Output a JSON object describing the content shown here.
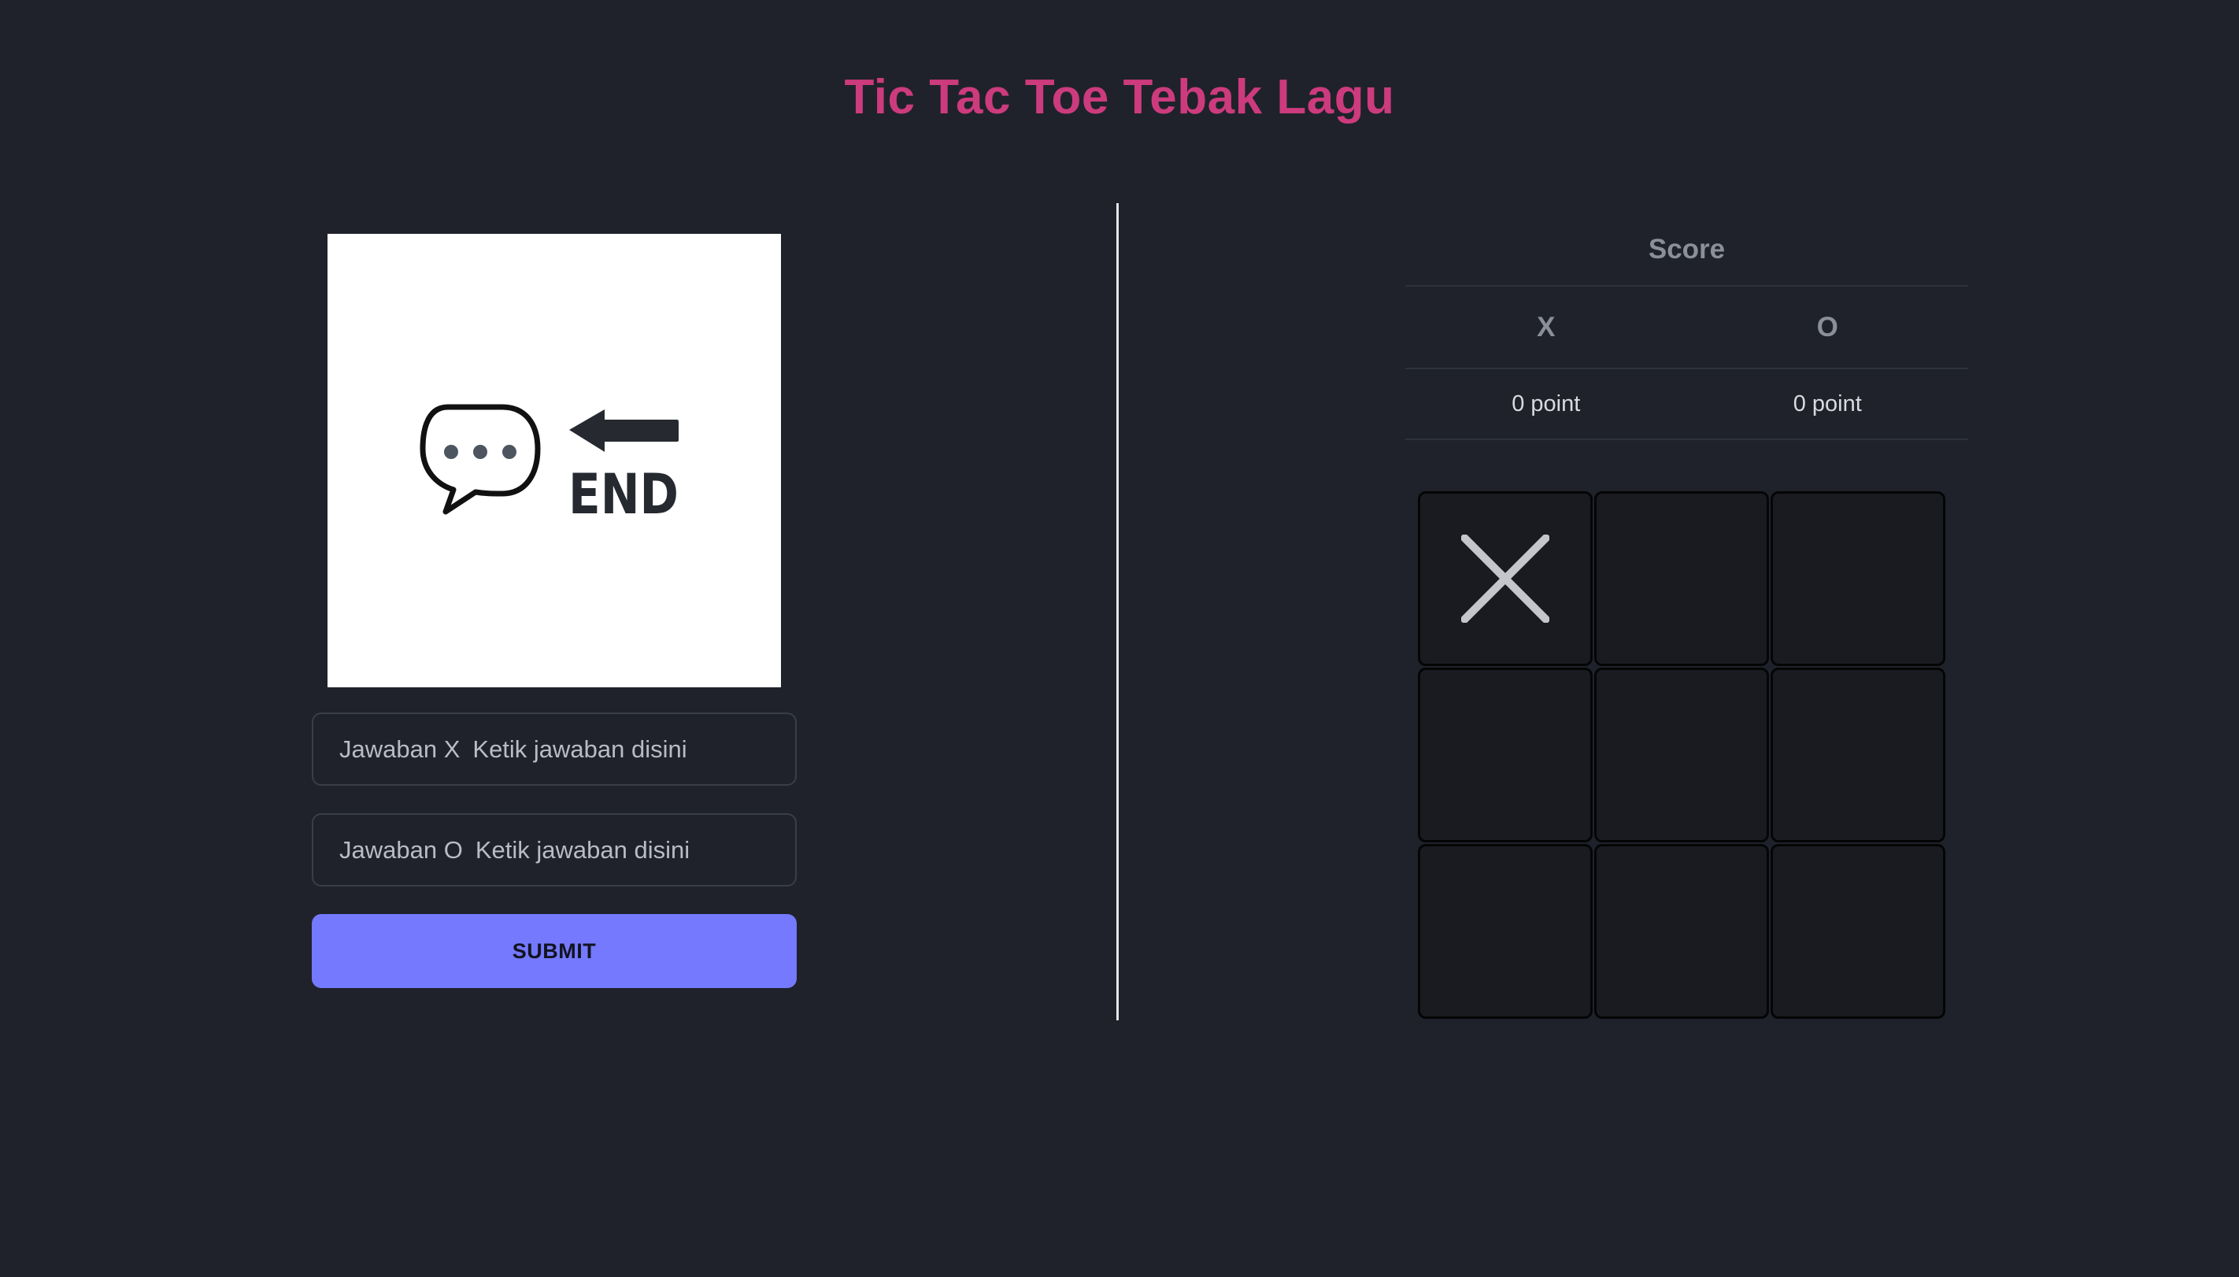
{
  "app": {
    "title": "Tic Tac Toe Tebak Lagu"
  },
  "image": {
    "icon": "speech-bubble-end-icon",
    "caption": "END"
  },
  "answers": {
    "x": {
      "label": "Jawaban X",
      "placeholder": "Ketik jawaban disini",
      "value": ""
    },
    "o": {
      "label": "Jawaban O",
      "placeholder": "Ketik jawaban disini",
      "value": ""
    }
  },
  "submit": {
    "label": "SUBMIT"
  },
  "score": {
    "title": "Score",
    "players": [
      {
        "name": "X",
        "points": "0 point"
      },
      {
        "name": "O",
        "points": "0 point"
      }
    ]
  },
  "board": {
    "cells": [
      "X",
      "",
      "",
      "",
      "",
      "",
      "",
      "",
      ""
    ]
  },
  "colors": {
    "background": "#1f222a",
    "title": "#cc3b7d",
    "submit": "#7479fe",
    "mark": "#c4c6cc"
  }
}
